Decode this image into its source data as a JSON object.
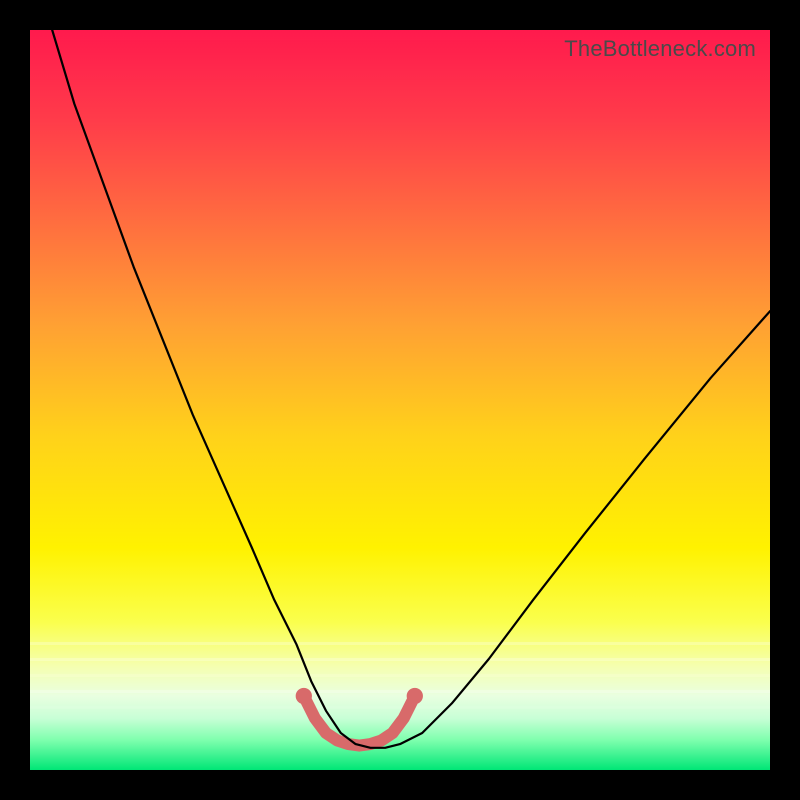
{
  "watermark": "TheBottleneck.com",
  "chart_data": {
    "type": "line",
    "title": "",
    "xlabel": "",
    "ylabel": "",
    "xlim": [
      0,
      100
    ],
    "ylim": [
      0,
      100
    ],
    "axes_visible": false,
    "grid": false,
    "legend": false,
    "background_gradient": {
      "direction": "vertical_top_to_bottom",
      "stops": [
        {
          "pos": 0.0,
          "color": "#ff1a4d"
        },
        {
          "pos": 0.12,
          "color": "#ff3b4a"
        },
        {
          "pos": 0.25,
          "color": "#ff6a40"
        },
        {
          "pos": 0.4,
          "color": "#ffa133"
        },
        {
          "pos": 0.55,
          "color": "#ffd21a"
        },
        {
          "pos": 0.7,
          "color": "#fff200"
        },
        {
          "pos": 0.82,
          "color": "#f7ff33"
        },
        {
          "pos": 0.88,
          "color": "#ecffb3"
        },
        {
          "pos": 0.92,
          "color": "#d8ffd8"
        },
        {
          "pos": 0.96,
          "color": "#66ff99"
        },
        {
          "pos": 1.0,
          "color": "#00e676"
        }
      ]
    },
    "series": [
      {
        "name": "bottleneck-curve",
        "color": "#000000",
        "thickness": 2,
        "x": [
          3,
          6,
          10,
          14,
          18,
          22,
          26,
          30,
          33,
          36,
          38,
          40,
          42,
          44,
          46,
          48,
          50,
          53,
          57,
          62,
          68,
          75,
          83,
          92,
          100
        ],
        "y": [
          100,
          90,
          79,
          68,
          58,
          48,
          39,
          30,
          23,
          17,
          12,
          8,
          5,
          3.5,
          3,
          3,
          3.5,
          5,
          9,
          15,
          23,
          32,
          42,
          53,
          62
        ]
      },
      {
        "name": "highlight-band",
        "color": "#d86a6a",
        "thickness": 10,
        "x": [
          37,
          38.5,
          40,
          41.5,
          43,
          44.5,
          46,
          47.5,
          49,
          50.5,
          52
        ],
        "y": [
          10,
          7,
          5,
          4,
          3.5,
          3.3,
          3.5,
          4,
          5,
          7,
          10
        ],
        "endpoint_markers": true,
        "marker_radius": 7
      }
    ],
    "description": "V-shaped bottleneck curve over a vertical rainbow heat gradient (red at top, green at bottom). Minimum around x≈45, y≈3. A thick muted-red band highlights the trough region roughly x∈[37,52]."
  }
}
